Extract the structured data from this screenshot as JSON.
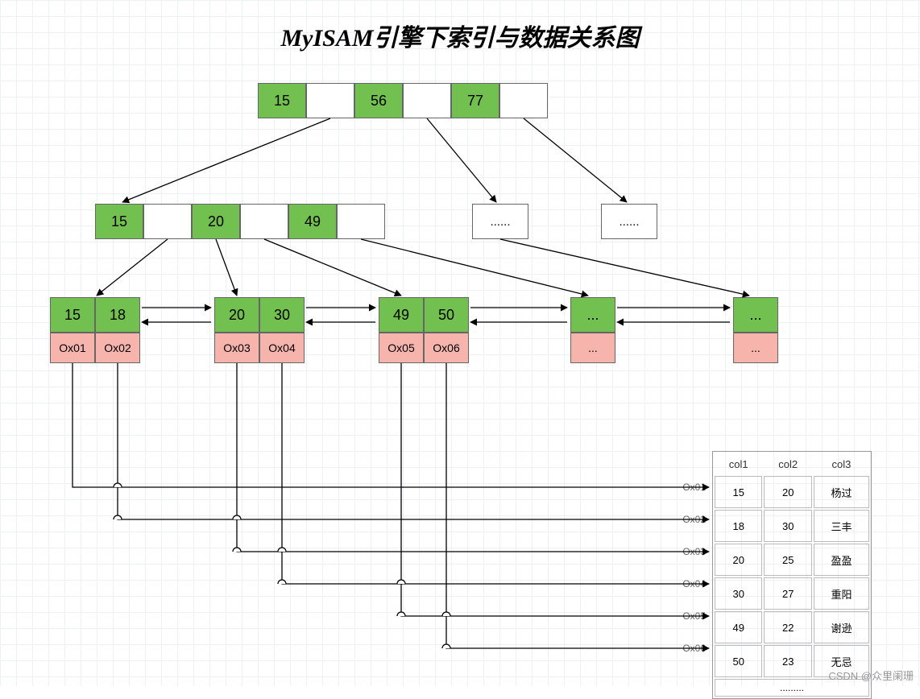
{
  "title": "MyISAM引擎下索引与数据关系图",
  "root": {
    "k1": "15",
    "k2": "56",
    "k3": "77"
  },
  "mid": {
    "k1": "15",
    "k2": "20",
    "k3": "49",
    "d1": "......",
    "d2": "......"
  },
  "leaf1": {
    "k1": "15",
    "k2": "18",
    "p1": "Ox01",
    "p2": "Ox02"
  },
  "leaf2": {
    "k1": "20",
    "k2": "30",
    "p1": "Ox03",
    "p2": "Ox04"
  },
  "leaf3": {
    "k1": "49",
    "k2": "50",
    "p1": "Ox05",
    "p2": "Ox06"
  },
  "leaf4": {
    "k": "...",
    "p": "..."
  },
  "leaf5": {
    "k": "...",
    "p": "..."
  },
  "table": {
    "headers": {
      "c1": "col1",
      "c2": "col2",
      "c3": "col3"
    },
    "rows": [
      {
        "addr": "Ox01",
        "c1": "15",
        "c2": "20",
        "c3": "杨过"
      },
      {
        "addr": "Ox02",
        "c1": "18",
        "c2": "30",
        "c3": "三丰"
      },
      {
        "addr": "Ox03",
        "c1": "20",
        "c2": "25",
        "c3": "盈盈"
      },
      {
        "addr": "Ox04",
        "c1": "30",
        "c2": "27",
        "c3": "重阳"
      },
      {
        "addr": "Ox05",
        "c1": "49",
        "c2": "22",
        "c3": "谢逊"
      },
      {
        "addr": "Ox06",
        "c1": "50",
        "c2": "23",
        "c3": "无忌"
      }
    ],
    "more": "........."
  },
  "watermark": "CSDN @众里阑珊"
}
